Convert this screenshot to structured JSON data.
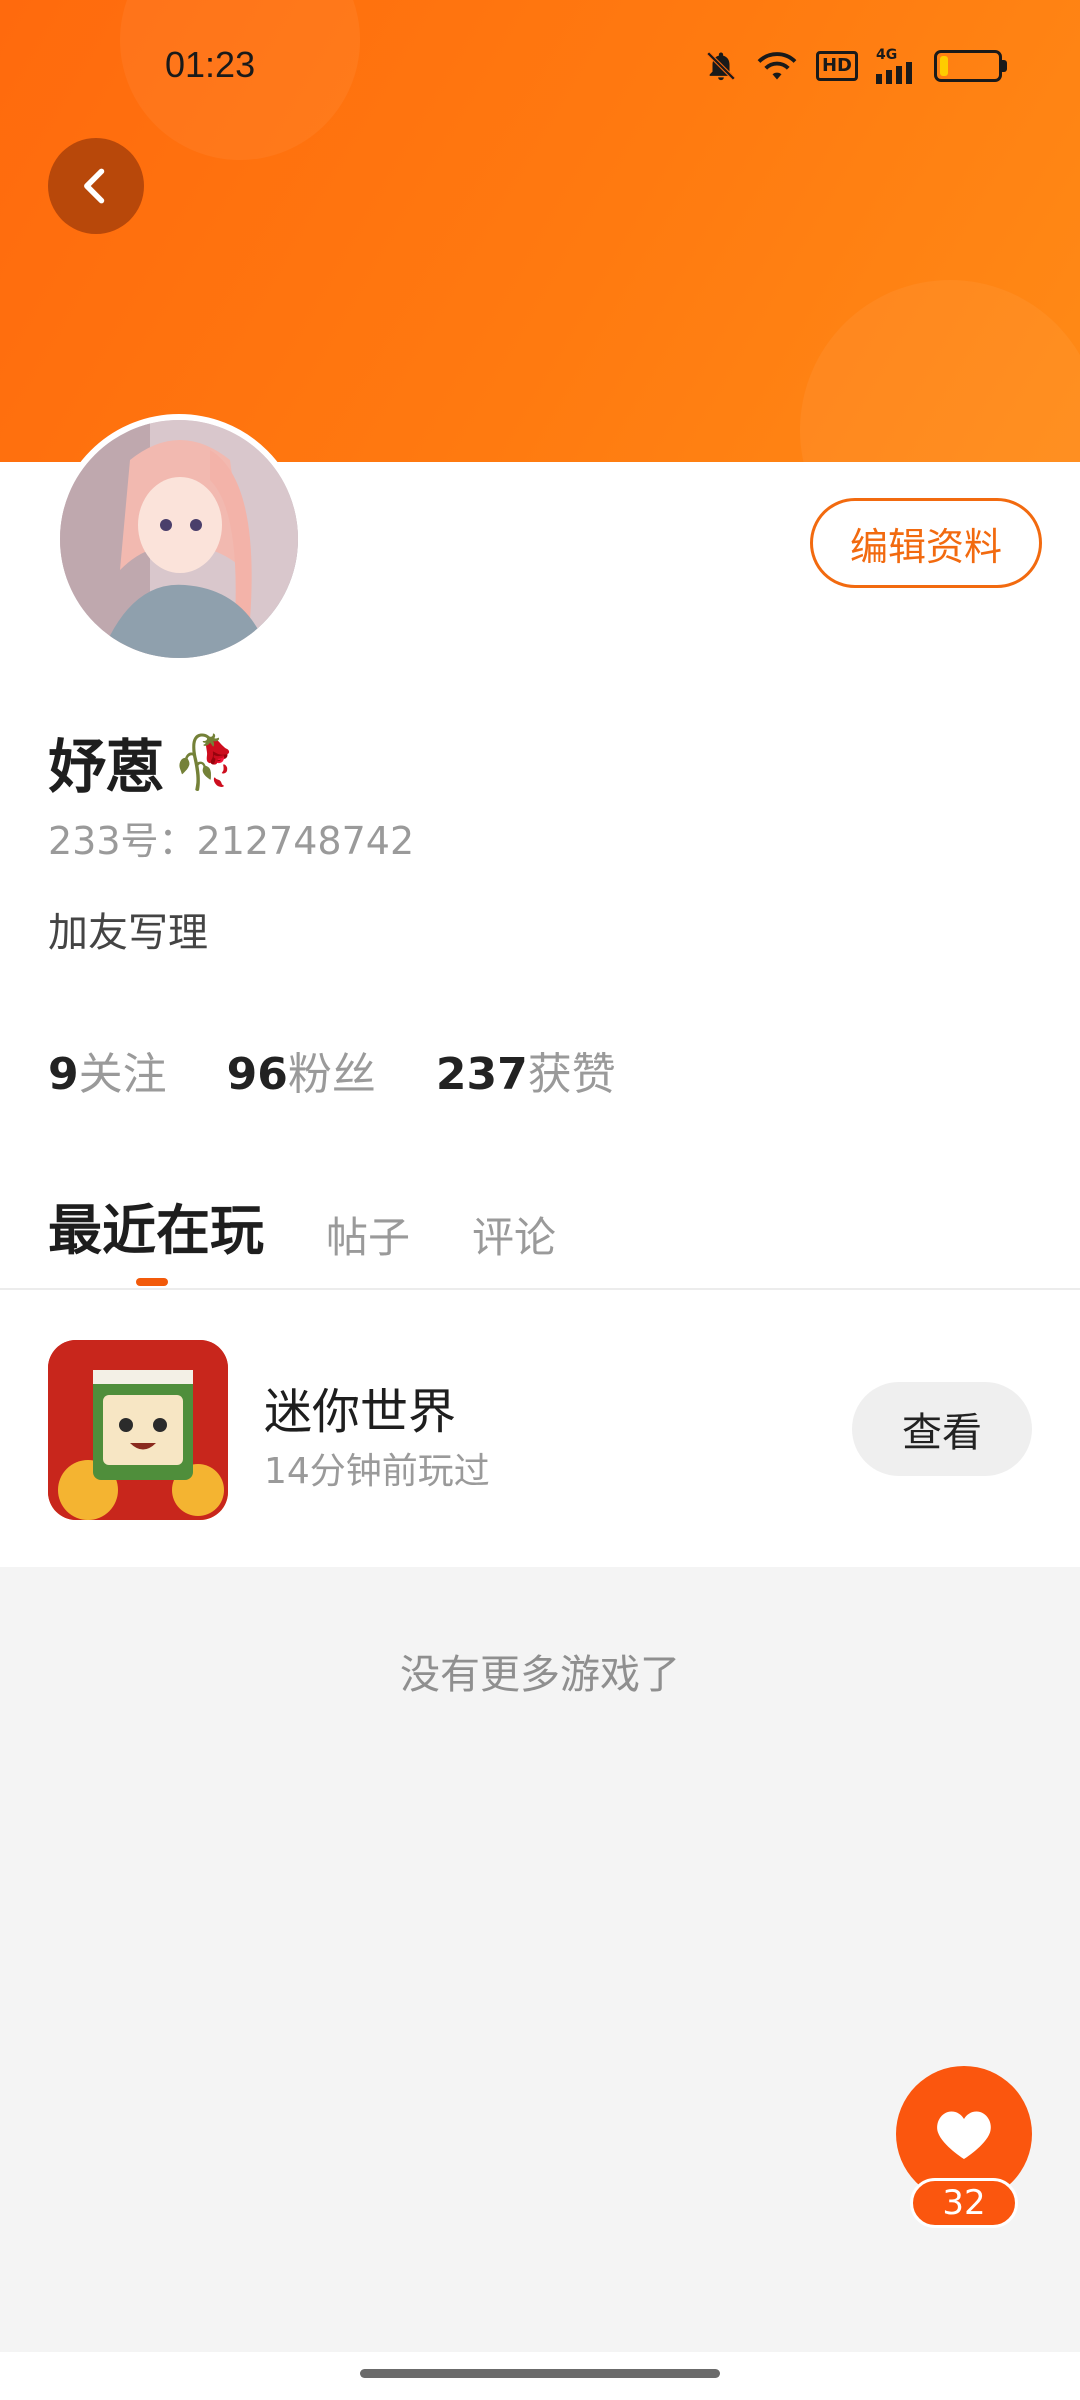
{
  "status_bar": {
    "time": "01:23",
    "network_label": "4G",
    "hd_label": "HD",
    "battery_level": 0.15,
    "icons": [
      "mute-bell-icon",
      "wifi-icon",
      "hd-icon",
      "signal-icon",
      "battery-icon"
    ]
  },
  "header": {
    "back_icon": "chevron-left-icon",
    "colors": {
      "gradient_start": "#ff6a0d",
      "gradient_end": "#ff8a16",
      "back_button": "#b8480a"
    }
  },
  "profile": {
    "nickname": "妤蒽",
    "nickname_emoji": "🥀",
    "user_id": "233号：212748742",
    "bio": "加友写理",
    "edit_button_label": "编辑资料",
    "accent_color": "#f26a0f"
  },
  "stats": [
    {
      "value": "9",
      "label": "关注"
    },
    {
      "value": "96",
      "label": "粉丝"
    },
    {
      "value": "237",
      "label": "获赞"
    }
  ],
  "tabs": [
    {
      "label": "最近在玩",
      "active": true
    },
    {
      "label": "帖子",
      "active": false
    },
    {
      "label": "评论",
      "active": false
    }
  ],
  "recent_games": [
    {
      "name": "迷你世界",
      "played": "14分钟前玩过",
      "button_label": "查看"
    }
  ],
  "empty_text": "没有更多游戏了",
  "fab": {
    "icon": "heart-icon",
    "count": "32",
    "color": "#fb560e"
  }
}
